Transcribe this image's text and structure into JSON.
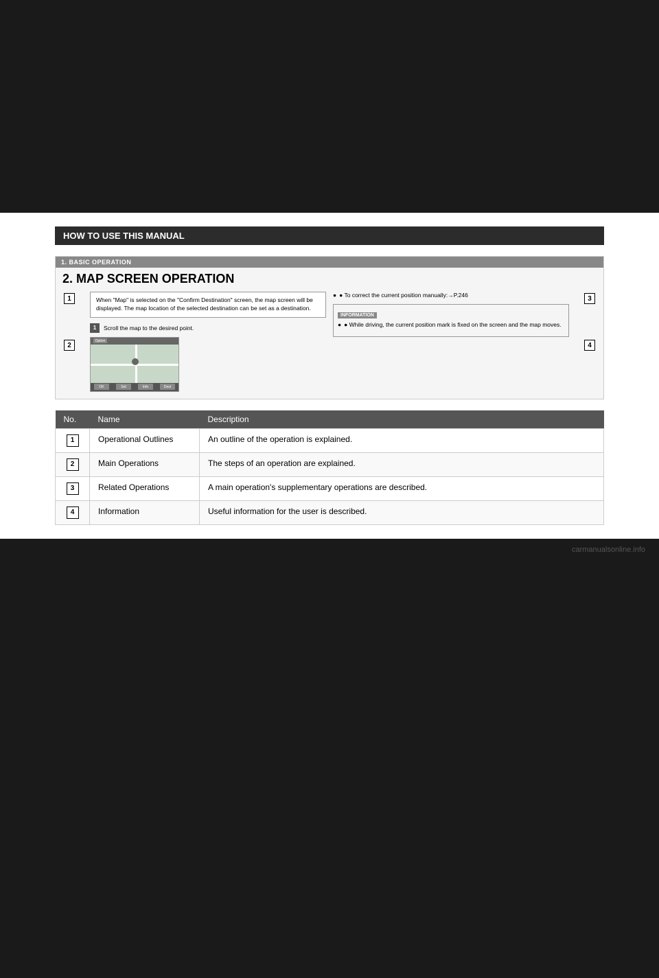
{
  "page": {
    "background_top_height": 310,
    "background_bottom_height": 640
  },
  "section_header": "HOW TO USE THIS MANUAL",
  "diagram": {
    "header": "1. BASIC OPERATION",
    "title": "2. MAP SCREEN OPERATION",
    "left_text_box": "When \"Map\" is selected on the \"Confirm Destination\" screen, the map screen will be displayed. The map location of the selected destination can be set as a destination.",
    "step_number": "1",
    "step_text": "Scroll the map to the desired point.",
    "right_bullet": "● To correct the current position manually:→P.246",
    "info_label": "INFORMATION",
    "info_bullet": "● While driving, the current position mark is fixed on the screen and the map moves.",
    "labels": [
      "1",
      "2",
      "3",
      "4"
    ]
  },
  "table": {
    "headers": [
      "No.",
      "Name",
      "Description"
    ],
    "rows": [
      {
        "no": "1",
        "name": "Operational Outlines",
        "description": "An outline of the operation is explained."
      },
      {
        "no": "2",
        "name": "Main Operations",
        "description": "The steps of an operation are explained."
      },
      {
        "no": "3",
        "name": "Related Operations",
        "description": "A main operation's supplementary operations are described."
      },
      {
        "no": "4",
        "name": "Information",
        "description": "Useful information for the user is described."
      }
    ]
  },
  "watermark": "carmanualsonline.info"
}
